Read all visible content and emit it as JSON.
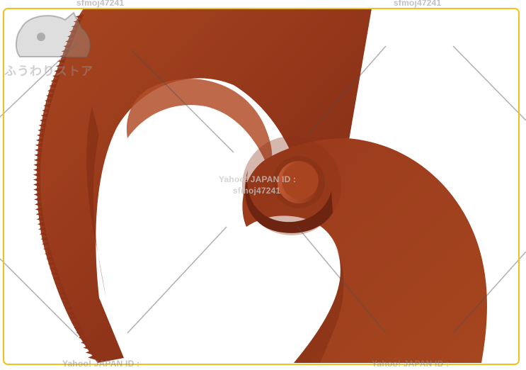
{
  "image": {
    "subject": "cable cutter blades",
    "colors": {
      "blade": "#9a3a1e",
      "blade_dark": "#6e2511",
      "blade_light": "#b8532f",
      "frame": "#f0c419",
      "background": "#ffffff"
    }
  },
  "watermarks": {
    "top_left": "sfmoj47241",
    "top_right": "sfmoj47241",
    "center_line1": "Yahoo! JAPAN ID :",
    "center_line2": "sfmoj47241",
    "bottom_left": "Yahoo! JAPAN ID :",
    "bottom_right": "Yahoo! JAPAN ID :"
  },
  "logo": {
    "text": "ふうわりストア"
  }
}
